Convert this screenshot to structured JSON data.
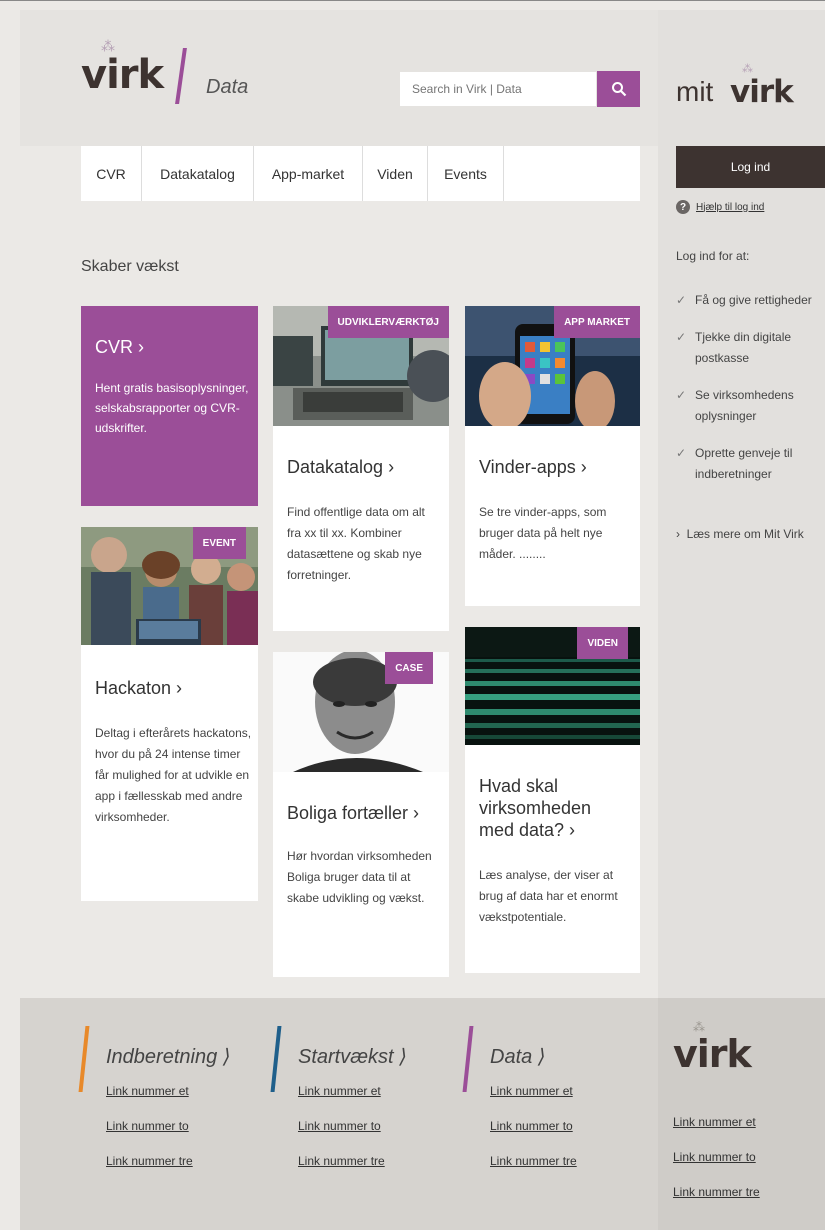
{
  "header": {
    "logo_text": "virk",
    "logo_subtitle": "Data",
    "search_placeholder": "Search in Virk | Data",
    "mit_text": "mit",
    "mit_logo_text": "virk"
  },
  "nav": {
    "items": [
      "CVR",
      "Datakatalog",
      "App-market",
      "Viden",
      "Events"
    ]
  },
  "sidebar": {
    "login_label": "Log ind",
    "help_label": "Hjælp til log ind",
    "heading": "Log ind for at:",
    "items": [
      "Få og give rettigheder",
      "Tjekke din digitale postkasse",
      "Se virksomhedens oplysninger",
      "Oprette genveje til indberetninger"
    ],
    "more_label": "Læs mere om Mit Virk"
  },
  "content": {
    "intro": "Skaber vækst",
    "cvr": {
      "title": "CVR ›",
      "text": "Hent gratis basisoplysninger, selskabsrapporter og CVR-udskrifter."
    },
    "hackaton": {
      "tag": "EVENT",
      "title": "Hackaton ›",
      "text": "Deltag i efterårets hackatons, hvor du på 24 intense timer får mulighed for at udvikle en app i fællesskab med andre virksomheder."
    },
    "datakatalog": {
      "tag": "UDVIKLERVÆRKTØJ",
      "title": "Datakatalog ›",
      "text": "Find offentlige data om alt fra xx til xx. Kombiner datasættene og skab nye forretninger."
    },
    "boliga": {
      "tag": "CASE",
      "title": "Boliga fortæller ›",
      "text": "Hør hvordan virksomheden Boliga bruger data til at skabe udvikling og vækst."
    },
    "vinder": {
      "tag": "APP MARKET",
      "title": "Vinder-apps ›",
      "text": "Se tre vinder-apps, som bruger data på helt nye måder. ........"
    },
    "hvad": {
      "tag": "VIDEN",
      "title": "Hvad skal virksomheden med data? ›",
      "text": "Læs analyse, der viser at brug af data har et enormt vækstpotentiale."
    }
  },
  "footer": {
    "columns": [
      {
        "heading": "Indberetning ⟩",
        "color": "#e8892a",
        "links": [
          "Link nummer et",
          "Link nummer to",
          "Link nummer tre"
        ]
      },
      {
        "heading": "Startvækst ⟩",
        "color": "#1f5f8b",
        "links": [
          "Link nummer et",
          "Link nummer to",
          "Link nummer tre"
        ]
      },
      {
        "heading": "Data ⟩",
        "color": "#9b4e98",
        "links": [
          "Link nummer et",
          "Link nummer to",
          "Link nummer tre"
        ]
      }
    ],
    "logo_text": "virk",
    "side_links": [
      "Link nummer et",
      "Link nummer to",
      "Link nummer tre"
    ]
  },
  "colors": {
    "accent": "#9b4e98",
    "dark": "#3d3330",
    "background": "#ebe9e6"
  }
}
